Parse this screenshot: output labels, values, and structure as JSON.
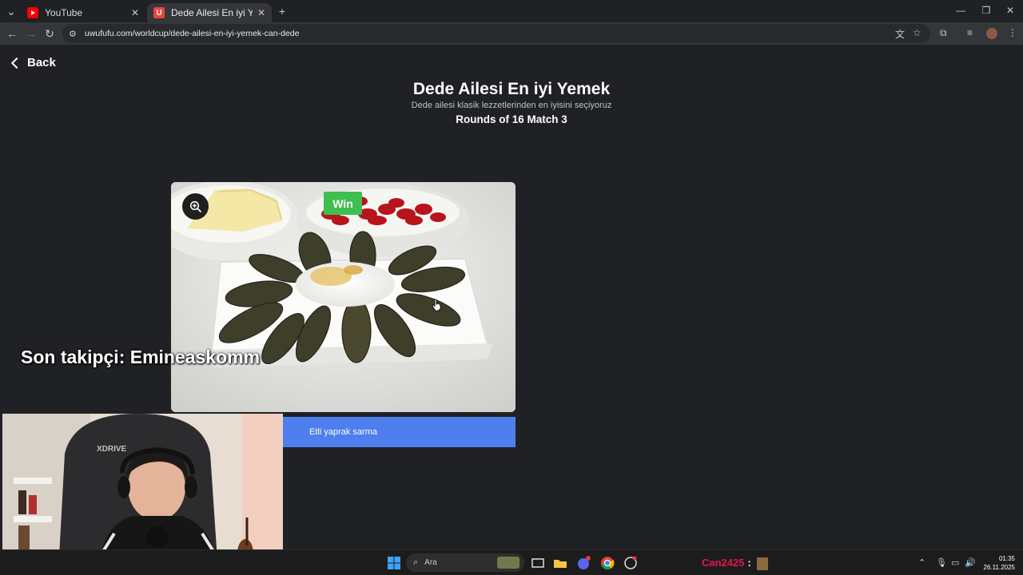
{
  "browser": {
    "tabs": [
      {
        "title": "YouTube",
        "favicon": "youtube-icon",
        "active": false
      },
      {
        "title": "Dede Ailesi En iyi Yemek | UwUfufu",
        "favicon": "uwufufu-icon",
        "active": true
      }
    ],
    "url": "uwufufu.com/worldcup/dede-ailesi-en-iyi-yemek-can-dede"
  },
  "page": {
    "back_label": "Back",
    "title": "Dede Ailesi En iyi Yemek",
    "description": "Dede ailesi klasik lezzetlerinden en iyisini seçiyoruz",
    "round": "Rounds of 16 Match 3",
    "option": {
      "badge": "Win",
      "caption": "Etli yaprak sarma",
      "image": "stuffed-grape-leaves-photo"
    }
  },
  "overlay": {
    "follower_text": "Son takipçi: Emineaskomm",
    "chair_brand": "XDRIVE"
  },
  "taskbar": {
    "search_placeholder": "Ara",
    "chat_user": "Can2425",
    "chat_sep": ":",
    "time": "01:35",
    "date": "26.11.2025"
  },
  "colors": {
    "background": "#202124",
    "win_badge": "#3fbf4f",
    "caption_bar": "#4f7fee",
    "chat_user": "#e0184f"
  }
}
